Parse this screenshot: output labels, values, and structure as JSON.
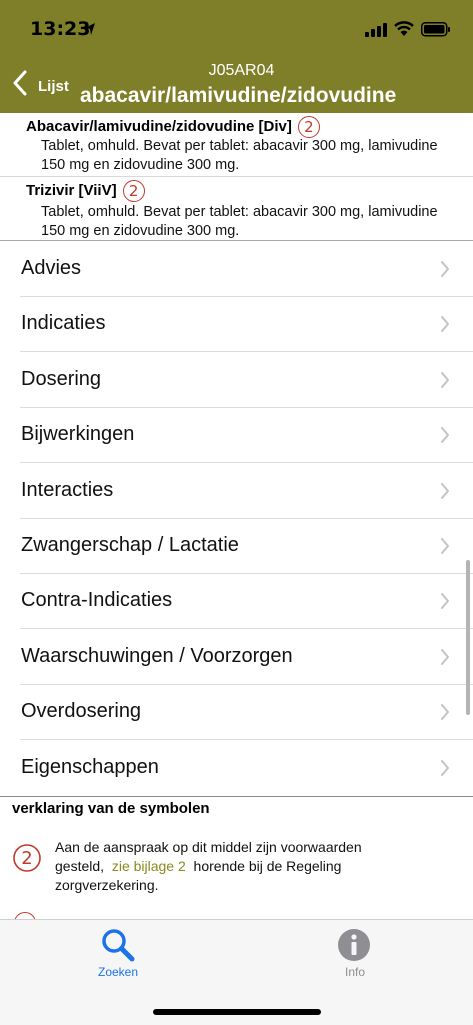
{
  "status_bar": {
    "time": "13:23"
  },
  "nav": {
    "back_label": "Lijst",
    "atc_code": "J05AR04",
    "title": "abacavir/lamivudine/zidovudine"
  },
  "products": [
    {
      "name": "Abacavir/lamivudine/zidovudine [Div]",
      "badge": "2",
      "description": "Tablet, omhuld. Bevat per tablet: abacavir 300 mg, lamivudine 150 mg en zidovudine 300 mg."
    },
    {
      "name": "Trizivir [ViiV]",
      "badge": "2",
      "description": "Tablet, omhuld. Bevat per tablet: abacavir 300 mg, lamivudine 150 mg en zidovudine 300 mg."
    }
  ],
  "menu": [
    "Advies",
    "Indicaties",
    "Dosering",
    "Bijwerkingen",
    "Interacties",
    "Zwangerschap / Lactatie",
    "Contra-Indicaties",
    "Waarschuwingen / Voorzorgen",
    "Overdosering",
    "Eigenschappen"
  ],
  "legend": {
    "heading": "verklaring van de symbolen",
    "symbol": "2",
    "text_before": "Aan de aanspraak op dit middel zijn voorwaarden gesteld,",
    "link": "zie bijlage 2",
    "text_after": "horende bij de Regeling zorgverzekering."
  },
  "tabs": [
    {
      "label": "Zoeken",
      "icon": "search-icon",
      "color": "#1a73e8",
      "active": true
    },
    {
      "label": "Info",
      "icon": "info-icon",
      "color": "#8e8e93",
      "active": false
    }
  ],
  "colors": {
    "header": "#7f7f2a",
    "badge": "#c0392b",
    "link": "#8a8a1f"
  }
}
